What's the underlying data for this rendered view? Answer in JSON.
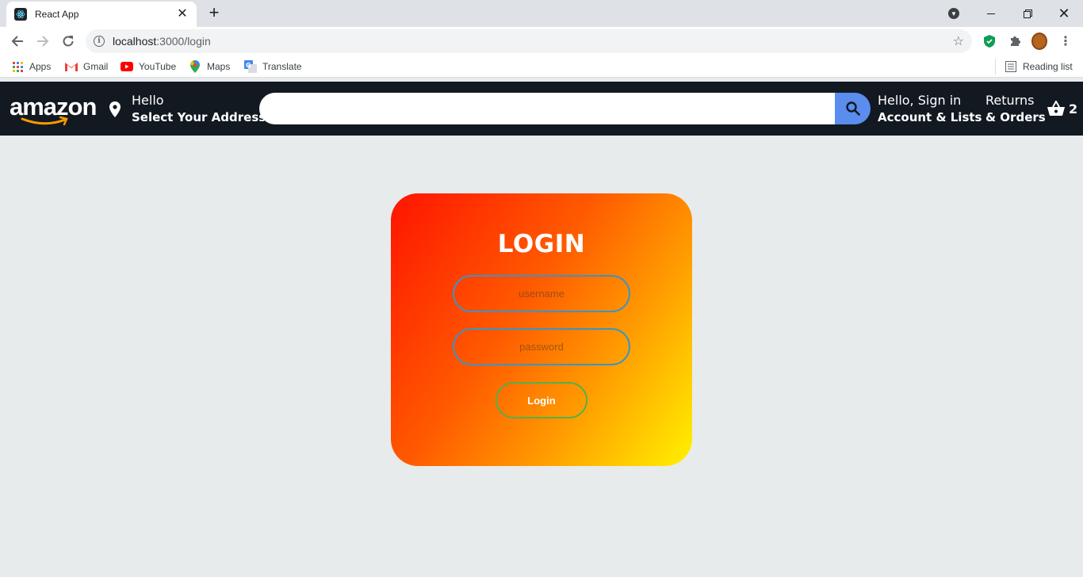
{
  "browser": {
    "tab_title": "React App",
    "url_host": "localhost",
    "url_rest": ":3000/login",
    "bookmarks": [
      {
        "label": "Apps",
        "icon": "apps-grid-icon"
      },
      {
        "label": "Gmail",
        "icon": "gmail-icon"
      },
      {
        "label": "YouTube",
        "icon": "youtube-icon"
      },
      {
        "label": "Maps",
        "icon": "maps-icon"
      },
      {
        "label": "Translate",
        "icon": "translate-icon"
      }
    ],
    "reading_list": "Reading list"
  },
  "header": {
    "logo": "amazon",
    "address_line1": "Hello",
    "address_line2": "Select Your Address",
    "search_placeholder": "",
    "signin_line1": "Hello, Sign in",
    "signin_line2": "Account & Lists",
    "returns_line1": "Returns",
    "returns_line2": "& Orders",
    "cart_count": "2"
  },
  "login": {
    "title": "LOGIN",
    "username_placeholder": "username",
    "password_placeholder": "password",
    "button_label": "Login"
  },
  "colors": {
    "header_bg": "#131921",
    "search_button": "#5a8dee",
    "page_bg": "#e8ebec",
    "input_border": "#3c94c4",
    "button_border": "#55b04a",
    "gradient_start": "#ff1400",
    "gradient_end": "#fff200"
  }
}
